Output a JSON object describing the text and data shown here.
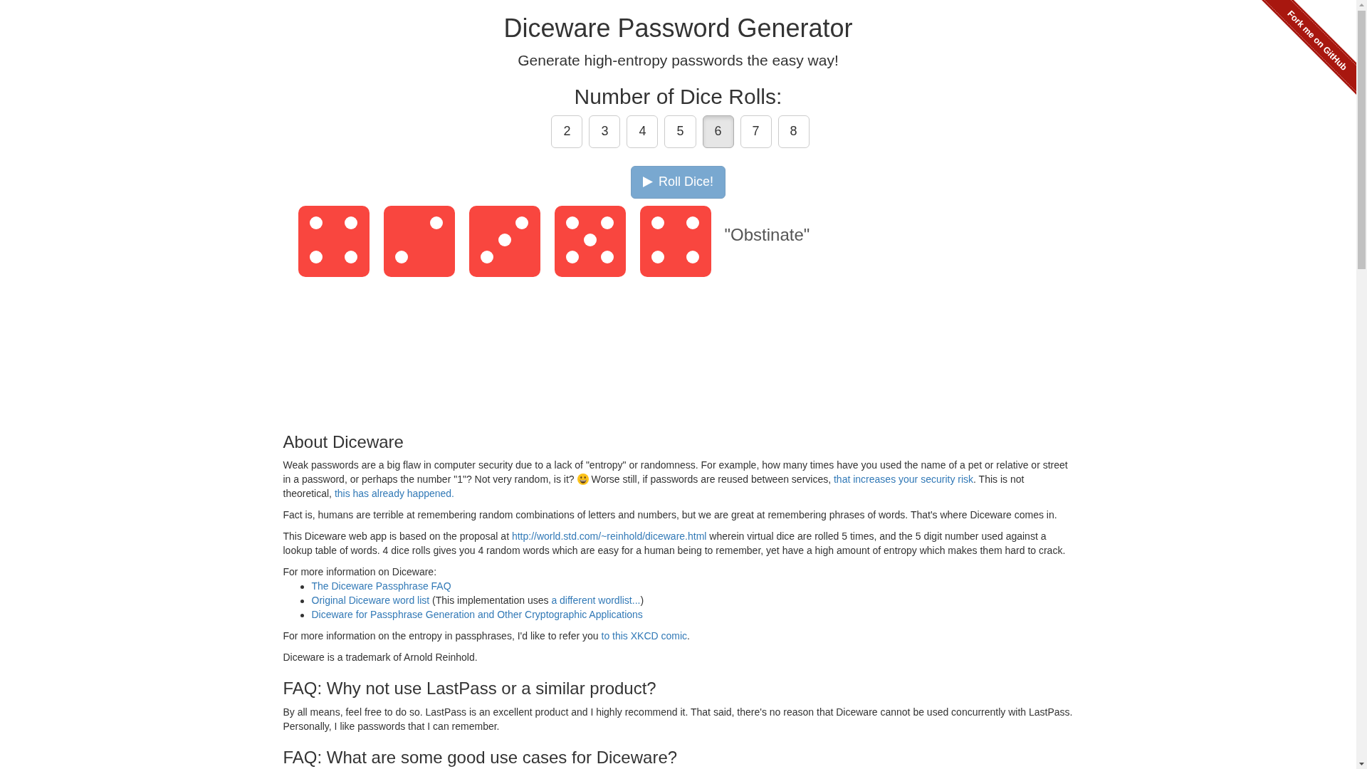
{
  "header": {
    "title": "Diceware Password Generator",
    "subtitle": "Generate high-entropy passwords the easy way!"
  },
  "github_ribbon": {
    "label": "Fork me on GitHub"
  },
  "dice_rolls": {
    "label": "Number of Dice Rolls:",
    "options": [
      {
        "label": "2",
        "selected": false
      },
      {
        "label": "3",
        "selected": false
      },
      {
        "label": "4",
        "selected": false
      },
      {
        "label": "5",
        "selected": false
      },
      {
        "label": "6",
        "selected": true
      },
      {
        "label": "7",
        "selected": false
      },
      {
        "label": "8",
        "selected": false
      }
    ]
  },
  "roll_button": {
    "label": "Roll Dice!",
    "disabled": true
  },
  "dice": [
    {
      "kind": "four"
    },
    {
      "kind": "two"
    },
    {
      "kind": "three"
    },
    {
      "kind": "five"
    },
    {
      "kind": "four"
    }
  ],
  "passphrase": "\"Obstinate\"",
  "sections": [
    {
      "heading": "About Diceware",
      "blocks": [
        {
          "kind": "paragraph",
          "parts": [
            {
              "kind": "text",
              "text": "Weak passwords are a big flaw in computer security due to a lack of \"entropy\" or randomness. For example, how many times have you used the name of a pet or relative or street in a password, or perhaps the number \"1\"? Not very random, is it? "
            },
            {
              "kind": "emoji"
            },
            {
              "kind": "text",
              "text": " Worse still, if passwords are reused between services, "
            },
            {
              "kind": "link",
              "text": "that increases your security risk"
            },
            {
              "kind": "text",
              "text": ". This is not theoretical, "
            },
            {
              "kind": "link",
              "text": "this has already happened."
            }
          ]
        },
        {
          "kind": "paragraph",
          "parts": [
            {
              "kind": "text",
              "text": "Fact is, humans are terrible at remembering random combinations of letters and numbers, but we are great at remembering phrases of words. That's where Diceware comes in."
            }
          ]
        },
        {
          "kind": "paragraph",
          "parts": [
            {
              "kind": "text",
              "text": "This Diceware web app is based on the proposal at "
            },
            {
              "kind": "link",
              "text": "http://world.std.com/~reinhold/diceware.html"
            },
            {
              "kind": "text",
              "text": " wherein virtual dice are rolled 5 times, and the 5 digit number used against a lookup table of words. 4 dice rolls gives you 4 random words which are easy for a human being to remember, yet have a high amount of entropy which makes them hard to crack."
            }
          ]
        },
        {
          "kind": "paragraph",
          "parts": [
            {
              "kind": "text",
              "text": "For more information on Diceware:"
            }
          ]
        },
        {
          "kind": "list",
          "items": [
            {
              "parts": [
                {
                  "kind": "link",
                  "text": "The Diceware Passphrase FAQ"
                }
              ]
            },
            {
              "parts": [
                {
                  "kind": "link",
                  "text": "Original Diceware word list"
                },
                {
                  "kind": "text",
                  "text": " (This implementation uses "
                },
                {
                  "kind": "link",
                  "text": "a different wordlist..."
                },
                {
                  "kind": "text",
                  "text": ")"
                }
              ]
            },
            {
              "parts": [
                {
                  "kind": "link",
                  "text": "Diceware for Passphrase Generation and Other Cryptographic Applications"
                }
              ]
            }
          ]
        },
        {
          "kind": "paragraph",
          "parts": [
            {
              "kind": "text",
              "text": "For more information on the entropy in passphrases, I'd like to refer you "
            },
            {
              "kind": "link",
              "text": "to this XKCD comic"
            },
            {
              "kind": "text",
              "text": "."
            }
          ]
        },
        {
          "kind": "paragraph",
          "parts": [
            {
              "kind": "text",
              "text": "Diceware is a trademark of Arnold Reinhold."
            }
          ]
        }
      ]
    },
    {
      "heading": "FAQ: Why not use LastPass or a similar product?",
      "blocks": [
        {
          "kind": "paragraph",
          "parts": [
            {
              "kind": "text",
              "text": "By all means, feel free to do so. LastPass is an excellent product and I highly recommend it. That said, there's no reason that Diceware cannot be used concurrently with LastPass. Personally, I like passwords that I can remember."
            }
          ]
        }
      ]
    },
    {
      "heading": "FAQ: What are some good use cases for Diceware?"
    }
  ]
}
